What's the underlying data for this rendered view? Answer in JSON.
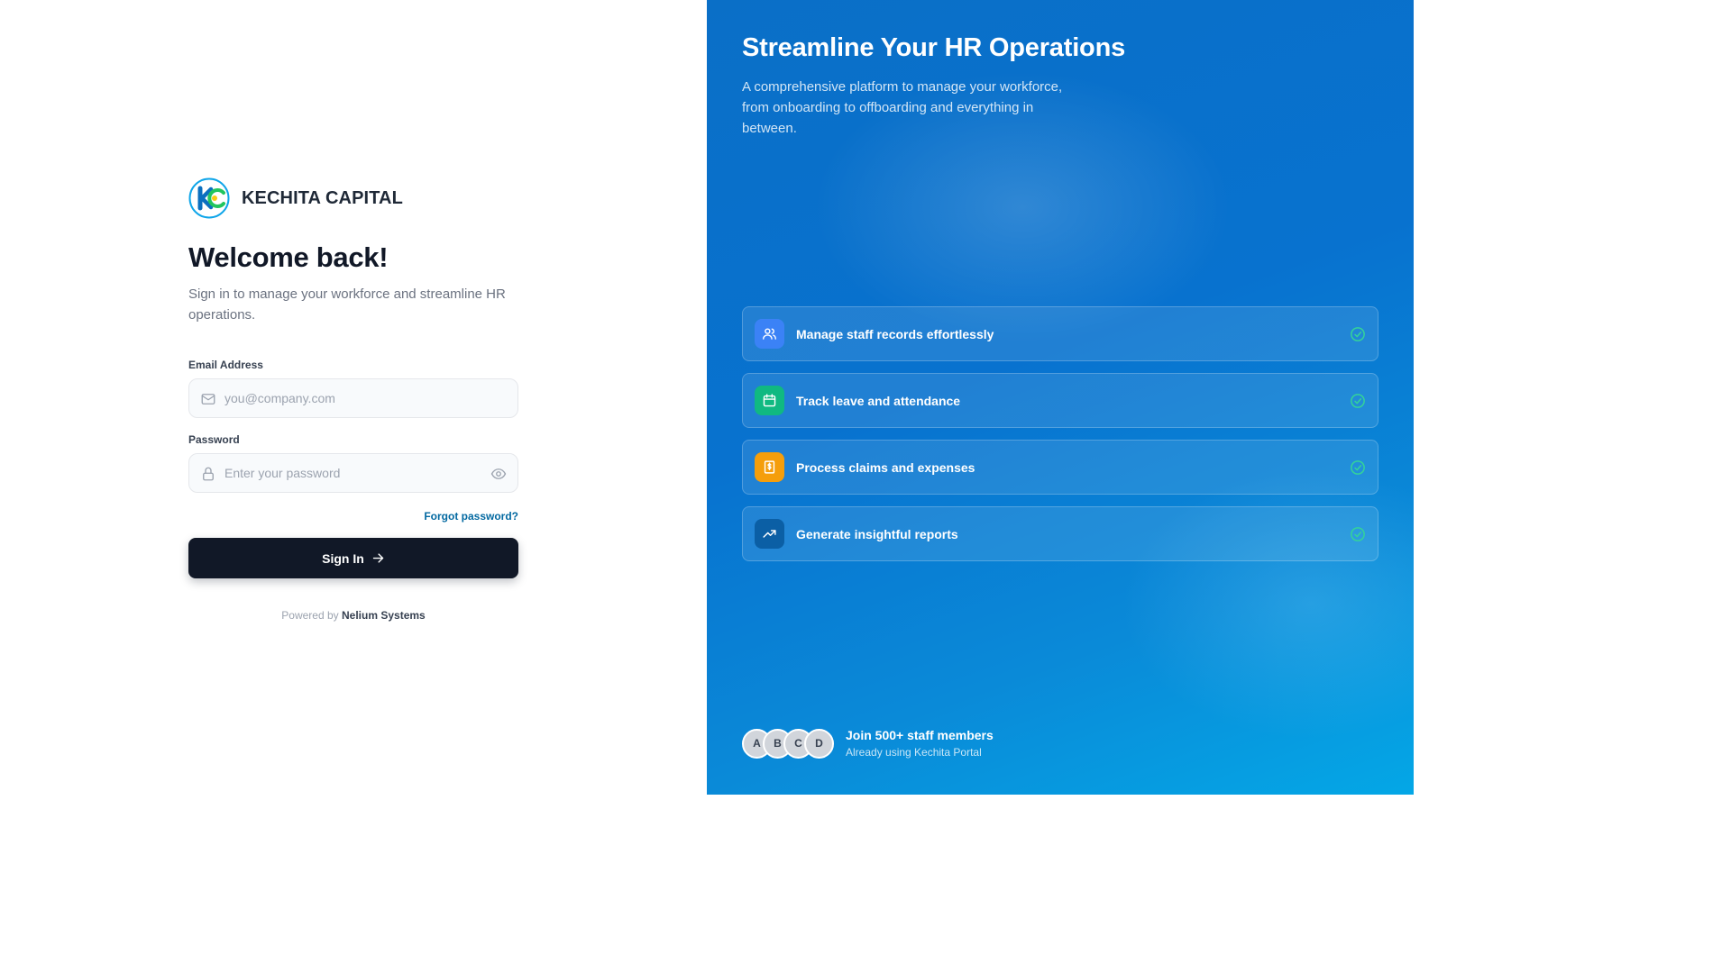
{
  "brand": {
    "name": "KECHITA CAPITAL",
    "logo_icon": "kc-logo-icon"
  },
  "login": {
    "title": "Welcome back!",
    "subtitle": "Sign in to manage your workforce and streamline HR operations.",
    "email_label": "Email Address",
    "email_placeholder": "you@company.com",
    "email_value": "",
    "password_label": "Password",
    "password_placeholder": "Enter your password",
    "password_value": "",
    "forgot_label": "Forgot password?",
    "signin_label": "Sign In",
    "powered_prefix": "Powered by",
    "powered_company": "Nelium Systems"
  },
  "hero": {
    "title": "Streamline Your HR Operations",
    "description": "A comprehensive platform to manage your workforce, from onboarding to offboarding and everything in between."
  },
  "features": [
    {
      "label": "Manage staff records effortlessly",
      "icon": "users-icon",
      "color": "#3b82f6"
    },
    {
      "label": "Track leave and attendance",
      "icon": "calendar-icon",
      "color": "#10b981"
    },
    {
      "label": "Process claims and expenses",
      "icon": "receipt-icon",
      "color": "#f59e0b"
    },
    {
      "label": "Generate insightful reports",
      "icon": "trending-up-icon",
      "color": "#0b5fa5"
    }
  ],
  "social": {
    "avatars": [
      "A",
      "B",
      "C",
      "D"
    ],
    "title": "Join 500+ staff members",
    "subtitle": "Already using Kechita Portal"
  },
  "colors": {
    "primary_button": "#111827",
    "link": "#0369a1",
    "panel_blue": "#0872cf",
    "check_green": "#34d399"
  }
}
